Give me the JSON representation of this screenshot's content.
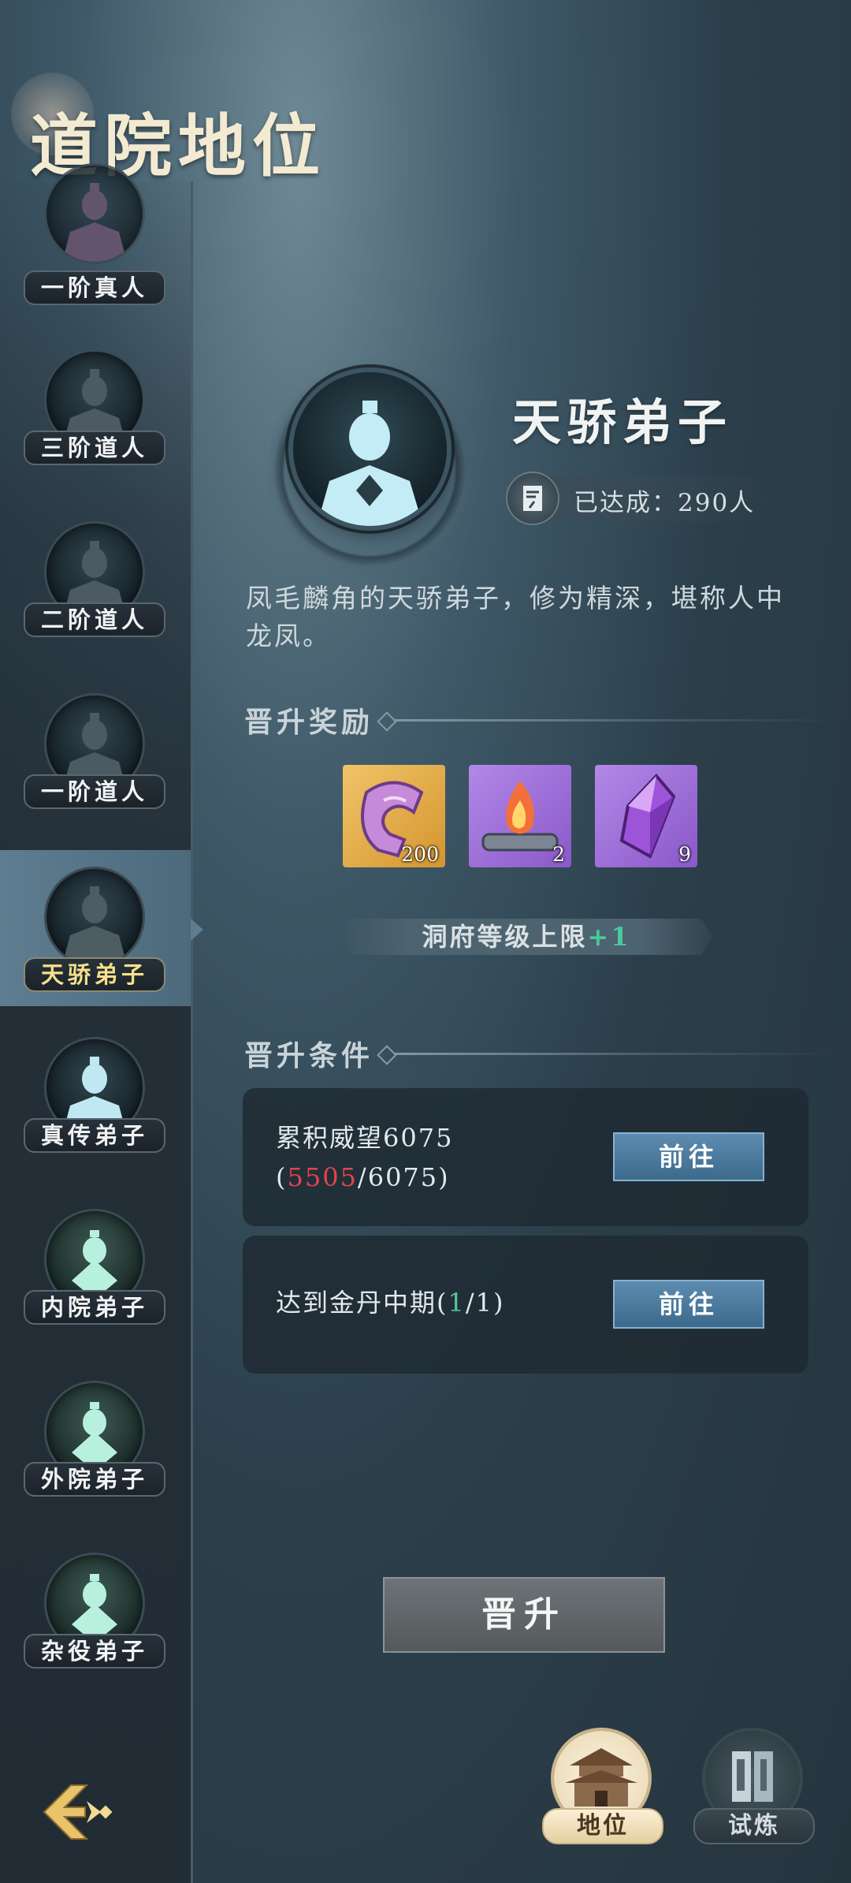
{
  "page": {
    "title": "道院地位"
  },
  "sidebar": {
    "items": [
      {
        "label": "一阶真人",
        "state": "locked"
      },
      {
        "label": "三阶道人",
        "state": "locked"
      },
      {
        "label": "二阶道人",
        "state": "locked"
      },
      {
        "label": "一阶道人",
        "state": "locked"
      },
      {
        "label": "天骄弟子",
        "state": "selected"
      },
      {
        "label": "真传弟子",
        "state": "achieved"
      },
      {
        "label": "内院弟子",
        "state": "achieved"
      },
      {
        "label": "外院弟子",
        "state": "achieved"
      },
      {
        "label": "杂役弟子",
        "state": "achieved"
      }
    ]
  },
  "detail": {
    "rank_name": "天骄弟子",
    "achieved_text": "已达成：290人",
    "description": "凤毛麟角的天骄弟子，修为精深，堪称人中龙凤。"
  },
  "rewards": {
    "heading": "晋升奖励",
    "items": [
      {
        "icon": "purple-talisman-icon",
        "count": "200",
        "bg": "#e2a94a"
      },
      {
        "icon": "fire-scroll-icon",
        "count": "2",
        "bg": "#9a6ad6"
      },
      {
        "icon": "purple-crystal-icon",
        "count": "9",
        "bg": "#9a6ad6"
      }
    ],
    "cap_text": "洞府等级上限",
    "cap_plus": "+1"
  },
  "conditions": {
    "heading": "晋升条件",
    "items": [
      {
        "line1": "累积威望6075",
        "open": "(",
        "current": "5505",
        "sep": "/",
        "target": "6075",
        "close": ")",
        "button": "前往"
      },
      {
        "text": "达到金丹中期",
        "open": "(",
        "current": "1",
        "sep": "/",
        "target": "1",
        "close": ")",
        "button": "前往"
      }
    ]
  },
  "actions": {
    "promote_label": "晋升"
  },
  "bottom_tabs": [
    {
      "label": "地位",
      "icon": "palace-icon",
      "active": true
    },
    {
      "label": "试炼",
      "icon": "scroll-door-icon",
      "active": false
    }
  ],
  "colors": {
    "accent_red": "#e0454a",
    "accent_green": "#54c695",
    "selected_label": "#f7e08a"
  }
}
